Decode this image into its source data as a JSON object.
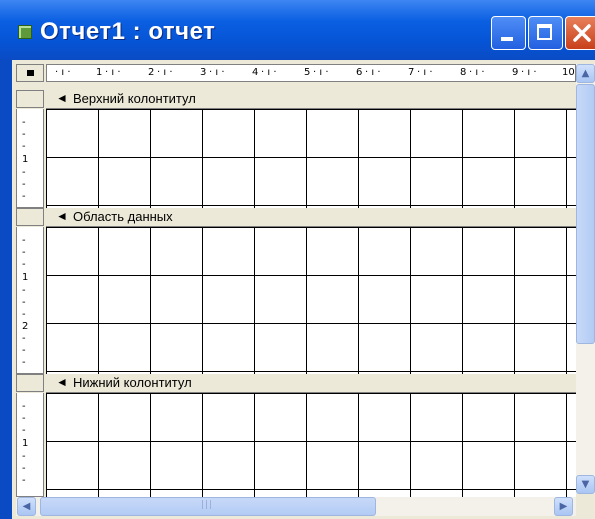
{
  "window": {
    "title": "Отчет1 : отчет"
  },
  "icons": {
    "app": "report-icon",
    "minimize": "minimize-icon",
    "maximize": "maximize-icon",
    "close": "close-icon",
    "section_marker": "section-arrow-icon"
  },
  "ruler": {
    "top_labels": [
      "1",
      "2",
      "3",
      "4",
      "5",
      "6",
      "7",
      "8",
      "9",
      "10"
    ],
    "left_labels_page_header": [
      "1"
    ],
    "left_labels_detail": [
      "1",
      "2"
    ],
    "left_labels_page_footer": [
      "1"
    ]
  },
  "sections": {
    "page_header": "Верхний колонтитул",
    "detail": "Область данных",
    "page_footer": "Нижний колонтитул"
  },
  "colors": {
    "titlebar": "#0654d6",
    "close_button": "#c8401a",
    "section_bar": "#ece9d8",
    "grid_line": "#000000"
  }
}
